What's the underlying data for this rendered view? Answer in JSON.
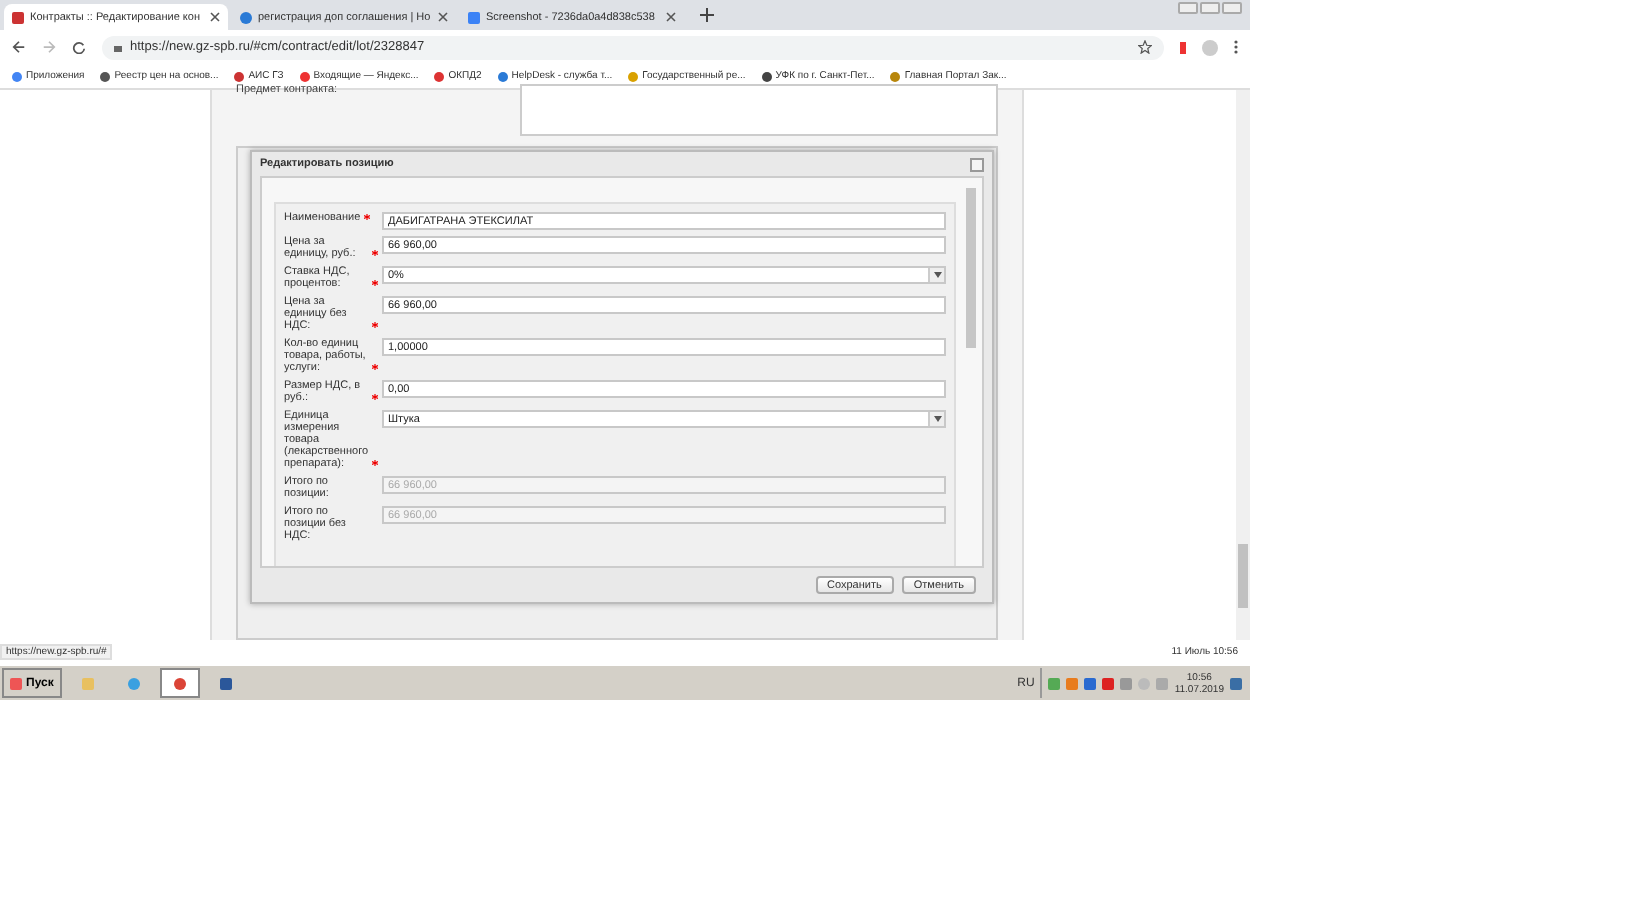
{
  "browser": {
    "tabs": [
      {
        "title": "Контракты :: Редактирование кон",
        "selected": true
      },
      {
        "title": "регистрация доп соглашения | Но",
        "selected": false
      },
      {
        "title": "Screenshot - 7236da0a4d838c538",
        "selected": false
      }
    ],
    "url": "https://new.gz-spb.ru/#cm/contract/edit/lot/2328847",
    "bookmarks": [
      "Приложения",
      "Реестр цен на основ...",
      "АИС ГЗ",
      "Входящие — Яндекс...",
      "ОКПД2",
      "HelpDesk - служба т...",
      "Государственный ре...",
      "УФК по г. Санкт-Пет...",
      "Главная Портал Зак..."
    ]
  },
  "page": {
    "subject_label": "Предмет контракта:"
  },
  "dialog": {
    "title": "Редактировать позицию",
    "fields": [
      {
        "label": "Наименование",
        "required": true,
        "value": "ДАБИГАТРАНА ЭТЕКСИЛАТ",
        "kind": "text"
      },
      {
        "label": "Цена за единицу, руб.:",
        "required": true,
        "value": "66 960,00",
        "kind": "text"
      },
      {
        "label": "Ставка НДС, процентов:",
        "required": true,
        "value": "0%",
        "kind": "select"
      },
      {
        "label": "Цена за единицу без НДС:",
        "required": true,
        "value": "66 960,00",
        "kind": "text"
      },
      {
        "label": "Кол-во единиц товара, работы, услуги:",
        "required": true,
        "value": "1,00000",
        "kind": "text"
      },
      {
        "label": "Размер НДС, в руб.:",
        "required": true,
        "value": "0,00",
        "kind": "text"
      },
      {
        "label": "Единица измерения товара (лекарственного препарата):",
        "required": true,
        "value": "Штука",
        "kind": "select"
      },
      {
        "label": "Итого по позиции:",
        "required": false,
        "value": "66 960,00",
        "kind": "disabled"
      },
      {
        "label": "Итого по позиции без НДС:",
        "required": false,
        "value": "66 960,00",
        "kind": "disabled"
      }
    ],
    "buttons": [
      "Сохранить",
      "Отменить"
    ]
  },
  "status_url": "https://new.gz-spb.ru/#",
  "status_time": "11 Июль 10:56",
  "taskbar": {
    "start": "Пуск",
    "language": "RU",
    "time": "10:56",
    "date": "11.07.2019"
  }
}
